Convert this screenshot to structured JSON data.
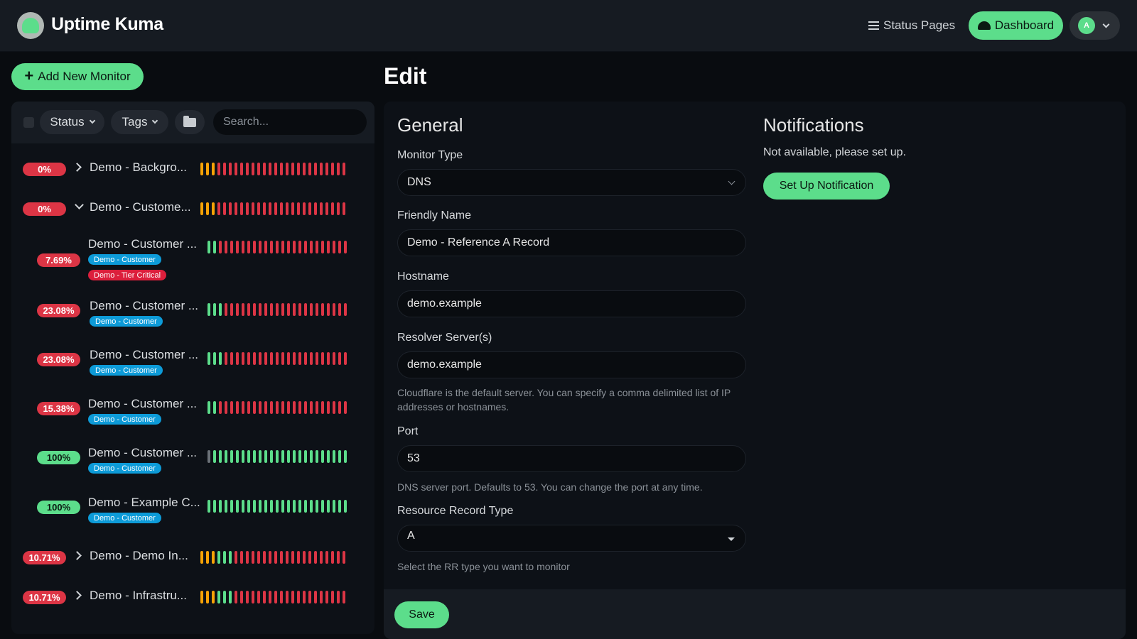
{
  "app": {
    "title": "Uptime Kuma"
  },
  "header": {
    "status_pages_label": "Status Pages",
    "dashboard_label": "Dashboard",
    "avatar_initial": "A"
  },
  "sidebar": {
    "add_button_label": "Add New Monitor",
    "filters": {
      "status_label": "Status",
      "tags_label": "Tags"
    },
    "search_placeholder": "Search...",
    "monitors": [
      {
        "uptime": "0%",
        "uptime_status": "down",
        "name": "Demo - Backgro...",
        "group": true,
        "expanded": false,
        "heartbeats": [
          "o",
          "o",
          "o",
          "r",
          "r",
          "r",
          "r",
          "r",
          "r",
          "r",
          "r",
          "r",
          "r",
          "r",
          "r",
          "r",
          "r",
          "r",
          "r",
          "r",
          "r",
          "r",
          "r",
          "r",
          "r",
          "r"
        ]
      },
      {
        "uptime": "0%",
        "uptime_status": "down",
        "name": "Demo - Custome...",
        "group": true,
        "expanded": true,
        "heartbeats": [
          "o",
          "o",
          "o",
          "r",
          "r",
          "r",
          "r",
          "r",
          "r",
          "r",
          "r",
          "r",
          "r",
          "r",
          "r",
          "r",
          "r",
          "r",
          "r",
          "r",
          "r",
          "r",
          "r",
          "r",
          "r",
          "r"
        ]
      },
      {
        "uptime": "7.69%",
        "uptime_status": "down",
        "name": "Demo - Customer ...",
        "tags": [
          {
            "label": "Demo - Customer",
            "color": "#0d9bd8"
          },
          {
            "label": "Demo - Tier Critical",
            "color": "#dc1f3c"
          }
        ],
        "heartbeats": [
          "g",
          "g",
          "r",
          "r",
          "r",
          "r",
          "r",
          "r",
          "r",
          "r",
          "r",
          "r",
          "r",
          "r",
          "r",
          "r",
          "r",
          "r",
          "r",
          "r",
          "r",
          "r",
          "r",
          "r",
          "r"
        ]
      },
      {
        "uptime": "23.08%",
        "uptime_status": "down",
        "name": "Demo - Customer ...",
        "tags": [
          {
            "label": "Demo - Customer",
            "color": "#0d9bd8"
          }
        ],
        "heartbeats": [
          "g",
          "g",
          "g",
          "r",
          "r",
          "r",
          "r",
          "r",
          "r",
          "r",
          "r",
          "r",
          "r",
          "r",
          "r",
          "r",
          "r",
          "r",
          "r",
          "r",
          "r",
          "r",
          "r",
          "r",
          "r"
        ]
      },
      {
        "uptime": "23.08%",
        "uptime_status": "down",
        "name": "Demo - Customer ...",
        "tags": [
          {
            "label": "Demo - Customer",
            "color": "#0d9bd8"
          }
        ],
        "heartbeats": [
          "g",
          "g",
          "g",
          "r",
          "r",
          "r",
          "r",
          "r",
          "r",
          "r",
          "r",
          "r",
          "r",
          "r",
          "r",
          "r",
          "r",
          "r",
          "r",
          "r",
          "r",
          "r",
          "r",
          "r",
          "r"
        ]
      },
      {
        "uptime": "15.38%",
        "uptime_status": "down",
        "name": "Demo - Customer ...",
        "tags": [
          {
            "label": "Demo - Customer",
            "color": "#0d9bd8"
          }
        ],
        "heartbeats": [
          "g",
          "g",
          "r",
          "r",
          "r",
          "r",
          "r",
          "r",
          "r",
          "r",
          "r",
          "r",
          "r",
          "r",
          "r",
          "r",
          "r",
          "r",
          "r",
          "r",
          "r",
          "r",
          "r",
          "r",
          "r"
        ]
      },
      {
        "uptime": "100%",
        "uptime_status": "up",
        "name": "Demo - Customer ...",
        "tags": [
          {
            "label": "Demo - Customer",
            "color": "#0d9bd8"
          }
        ],
        "heartbeats": [
          "x",
          "g",
          "g",
          "g",
          "g",
          "g",
          "g",
          "g",
          "g",
          "g",
          "g",
          "g",
          "g",
          "g",
          "g",
          "g",
          "g",
          "g",
          "g",
          "g",
          "g",
          "g",
          "g",
          "g",
          "g"
        ]
      },
      {
        "uptime": "100%",
        "uptime_status": "up",
        "name": "Demo - Example C...",
        "tags": [
          {
            "label": "Demo - Customer",
            "color": "#0d9bd8"
          }
        ],
        "heartbeats": [
          "g",
          "g",
          "g",
          "g",
          "g",
          "g",
          "g",
          "g",
          "g",
          "g",
          "g",
          "g",
          "g",
          "g",
          "g",
          "g",
          "g",
          "g",
          "g",
          "g",
          "g",
          "g",
          "g",
          "g",
          "g"
        ]
      },
      {
        "uptime": "10.71%",
        "uptime_status": "down",
        "name": "Demo - Demo In...",
        "group": true,
        "expanded": false,
        "heartbeats": [
          "o",
          "o",
          "o",
          "g",
          "g",
          "g",
          "r",
          "r",
          "r",
          "r",
          "r",
          "r",
          "r",
          "r",
          "r",
          "r",
          "r",
          "r",
          "r",
          "r",
          "r",
          "r",
          "r",
          "r",
          "r",
          "r"
        ]
      },
      {
        "uptime": "10.71%",
        "uptime_status": "down",
        "name": "Demo - Infrastru...",
        "group": true,
        "expanded": false,
        "heartbeats": [
          "o",
          "o",
          "o",
          "g",
          "g",
          "g",
          "r",
          "r",
          "r",
          "r",
          "r",
          "r",
          "r",
          "r",
          "r",
          "r",
          "r",
          "r",
          "r",
          "r",
          "r",
          "r",
          "r",
          "r",
          "r",
          "r"
        ]
      }
    ]
  },
  "edit": {
    "title": "Edit",
    "general_heading": "General",
    "monitor_type_label": "Monitor Type",
    "monitor_type_value": "DNS",
    "friendly_name_label": "Friendly Name",
    "friendly_name_value": "Demo - Reference A Record",
    "hostname_label": "Hostname",
    "hostname_value": "demo.example",
    "resolver_label": "Resolver Server(s)",
    "resolver_value": "demo.example",
    "resolver_help": "Cloudflare is the default server. You can specify a comma delimited list of IP addresses or hostnames.",
    "port_label": "Port",
    "port_value": "53",
    "port_help": "DNS server port. Defaults to 53. You can change the port at any time.",
    "rr_type_label": "Resource Record Type",
    "rr_type_value": "A",
    "rr_help": "Select the RR type you want to monitor",
    "save_label": "Save"
  },
  "notifications": {
    "heading": "Notifications",
    "empty_text": "Not available, please set up.",
    "setup_label": "Set Up Notification"
  },
  "colors": {
    "accent": "#5cdd8b",
    "down": "#dc3545",
    "up": "#5cdd8b",
    "pending": "#f8a306",
    "tag_customer": "#0d9bd8",
    "tag_critical": "#dc1f3c"
  }
}
